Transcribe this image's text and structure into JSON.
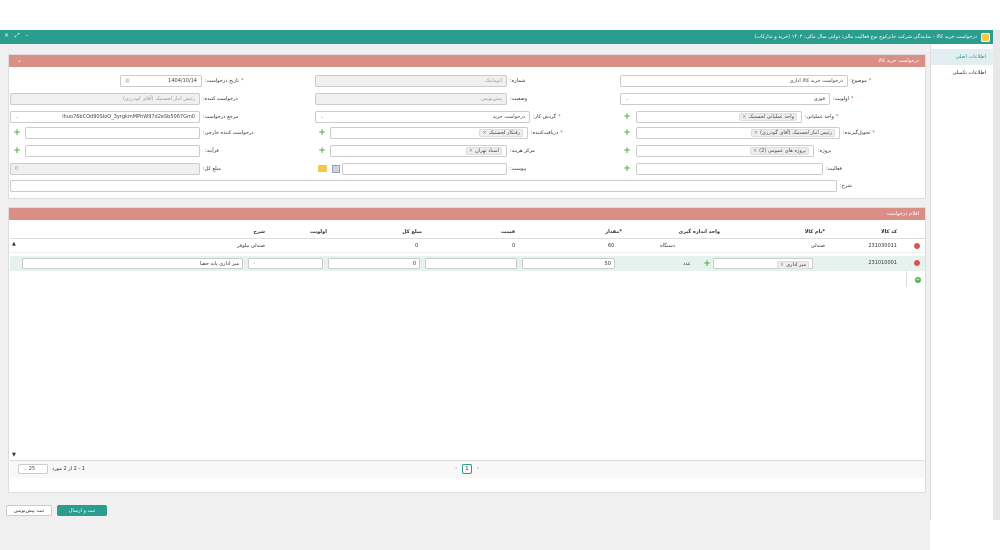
{
  "window": {
    "title": "درخواست خرید کالا - نمایندگی شرکت جابزکوچ نوع فعالیت مالی: دولتی سال مالی: ۱۴۰۴ (خرید و تدارکات)",
    "controls": "× ⤢ –"
  },
  "side_tabs": [
    {
      "label": "اطلاعات اصلی"
    },
    {
      "label": "اطلاعات تکمیلی"
    }
  ],
  "header_panel": {
    "title": "درخواست خرید کالا"
  },
  "form": {
    "subject": {
      "label": "موضوع:",
      "value": "درخواست خرید کالا اداری"
    },
    "number": {
      "label": "شماره:",
      "value": "اتوماتیک"
    },
    "request_date": {
      "label": "تاریخ درخواست:",
      "value": "1404/10/14"
    },
    "priority": {
      "label": "اولویت:",
      "value": "فوری"
    },
    "status": {
      "label": "وضعیت:",
      "value": "پیش‌نویس"
    },
    "requester": {
      "label": "درخواست کننده:",
      "value": "رئیس انبار لجستیک (آقای کودرزی)"
    },
    "operating_unit": {
      "label": "واحد عملیاتی:",
      "value": "واحد عملیاتی لجستیک"
    },
    "workflow_group": {
      "label": "گردش کار:",
      "value": "درخواست خرید"
    },
    "reference": {
      "label": "مرجع درخواست:",
      "value": "lhuo76bCOd90SIoO_3yrgkmMPhW97d2eSb5067Gm0"
    },
    "receiver": {
      "label": "تحویل‌گیرنده:",
      "value": "رئیس انبار لجستیک (آقای گودرزی)"
    },
    "recipient": {
      "label": "دریافت‌کننده:",
      "value": "رفتکار لجستیک"
    },
    "external_requester": {
      "label": "درخواست کننده خارجی:",
      "value": ""
    },
    "project": {
      "label": "پروژه:",
      "value": "پروژه های عمومی (2)"
    },
    "cost_center": {
      "label": "مرکز هزینه:",
      "value": "اسناد تهران"
    },
    "process": {
      "label": "فرآیند:",
      "value": ""
    },
    "activity": {
      "label": "فعالیت:",
      "value": ""
    },
    "attachment": {
      "label": "پیوست:",
      "value": ""
    },
    "total": {
      "label": "مبلغ کل:",
      "value": "0"
    },
    "description": {
      "label": "شرح:",
      "value": ""
    }
  },
  "items_panel": {
    "title": "اقلام درخواست"
  },
  "table": {
    "columns": [
      "کد کالا",
      "*نام کالا",
      "واحد اندازه گیری",
      "*مقدار",
      "قیمت",
      "مبلغ کل",
      "اولویت",
      "شرح"
    ],
    "rows": [
      {
        "code": "231030011",
        "name": "صندلی",
        "unit": "دستگاه",
        "qty": "60",
        "price": "0",
        "total": "0",
        "priority": "",
        "desc": "صندلی نیلوفر"
      },
      {
        "code": "231010001",
        "name": "میز اداری",
        "unit": "عدد",
        "qty": "50",
        "price": "",
        "total": "0",
        "priority": "",
        "desc": "میز اداری پایه حصا"
      }
    ]
  },
  "pagination": {
    "page": "1",
    "info": "1 - 2 از 2 مورد",
    "page_size": "25"
  },
  "buttons": {
    "save_send": "ثبت و ارسال",
    "save_draft": "ثبت پیش‌نویس"
  },
  "colors": {
    "titlebar": "#2a9d8f",
    "panel_header": "#d98f86",
    "accent_green": "#4caf50",
    "delete_red": "#d9534f",
    "primary_button": "#2a9d8f"
  }
}
